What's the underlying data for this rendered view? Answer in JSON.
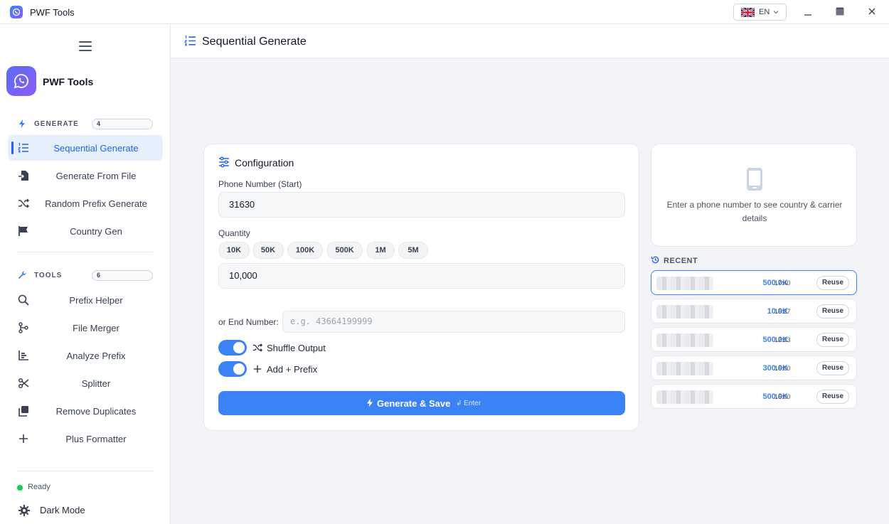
{
  "window": {
    "title": "PWF Tools",
    "language": "EN"
  },
  "sidebar": {
    "brand": "PWF Tools",
    "generate_section": {
      "label": "GENERATE",
      "count": "4"
    },
    "generate_items": [
      {
        "label": "Sequential Generate",
        "icon": "list-ordered-icon",
        "active": true
      },
      {
        "label": "Generate From File",
        "icon": "file-import-icon"
      },
      {
        "label": "Random Prefix Generate",
        "icon": "shuffle-icon"
      },
      {
        "label": "Country Gen",
        "icon": "flag-icon"
      }
    ],
    "tools_section": {
      "label": "TOOLS",
      "count": "6"
    },
    "tools_items": [
      {
        "label": "Prefix Helper",
        "icon": "search-icon"
      },
      {
        "label": "File Merger",
        "icon": "git-merge-icon"
      },
      {
        "label": "Analyze Prefix",
        "icon": "bar-chart-icon"
      },
      {
        "label": "Splitter",
        "icon": "scissors-icon"
      },
      {
        "label": "Remove Duplicates",
        "icon": "copy-icon"
      },
      {
        "label": "Plus Formatter",
        "icon": "plus-icon"
      }
    ],
    "status": "Ready",
    "dark_mode": "Dark Mode"
  },
  "header": {
    "title": "Sequential Generate"
  },
  "config": {
    "title": "Configuration",
    "phone_label": "Phone Number (Start)",
    "phone_value": "31630",
    "quantity_label": "Quantity",
    "quantity_chips": [
      "10K",
      "50K",
      "100K",
      "500K",
      "1M",
      "5M"
    ],
    "quantity_value": "10,000",
    "end_label": "or End Number:",
    "end_placeholder": "e.g. 43664199999",
    "shuffle_label": "Shuffle Output",
    "shuffle_on": true,
    "prefix_label": "Add + Prefix",
    "prefix_on": true,
    "generate_label": "Generate & Save",
    "generate_hint": "↲ Enter"
  },
  "info": {
    "message": "Enter a phone number to see country & carrier details"
  },
  "recent": {
    "label": "RECENT",
    "reuse_label": "Reuse",
    "items": [
      {
        "quantity": "500.0K",
        "time": "17:40",
        "selected": true
      },
      {
        "quantity": "10.0K",
        "time": "15:27"
      },
      {
        "quantity": "500.0K",
        "time": "12:23"
      },
      {
        "quantity": "300.0K",
        "time": "16:00"
      },
      {
        "quantity": "500.0K",
        "time": "16:00"
      }
    ]
  },
  "colors": {
    "accent": "#3b82f6",
    "active_bg": "#e6effc",
    "status": "#22c55e"
  }
}
